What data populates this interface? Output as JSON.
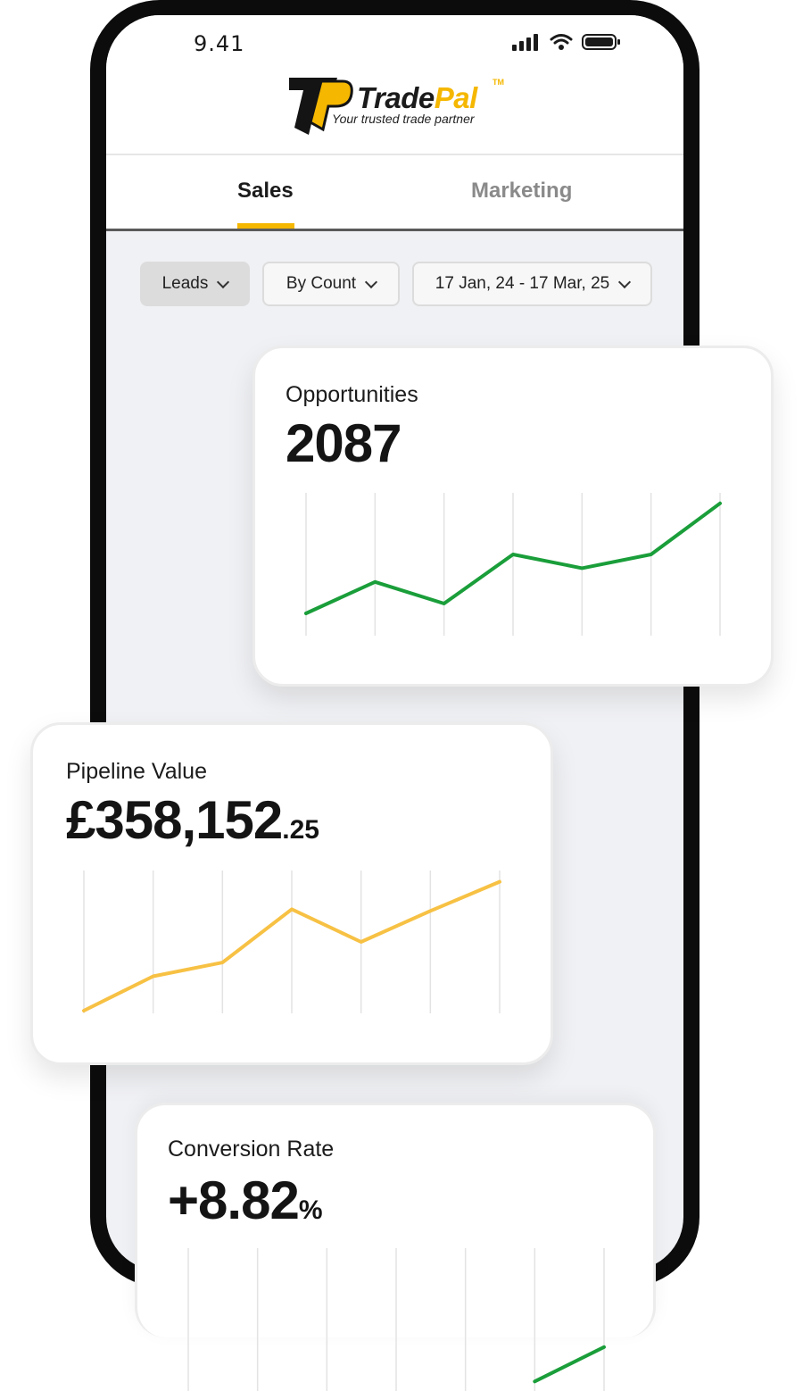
{
  "status": {
    "time": "9.41"
  },
  "brand": {
    "name_part1": "Trade",
    "name_part2": "Pal",
    "trademark": "TM",
    "tagline": "Your trusted trade partner",
    "monogram": "TP"
  },
  "tabs": [
    {
      "label": "Sales",
      "active": true
    },
    {
      "label": "Marketing",
      "active": false
    }
  ],
  "filters": {
    "metric": "Leads",
    "mode": "By Count",
    "date_range": "17 Jan, 24 - 17 Mar, 25"
  },
  "cards": {
    "opportunities": {
      "title": "Opportunities",
      "value": "2087"
    },
    "pipeline": {
      "title": "Pipeline Value",
      "value_main": "£358,152",
      "value_decimal": ".25"
    },
    "conversion": {
      "title": "Conversion Rate",
      "value_main": "+8.82",
      "value_unit": "%"
    }
  },
  "colors": {
    "accent": "#f5b700",
    "green": "#1a9e3a",
    "yellow": "#f7c144",
    "dark": "#141414"
  },
  "chart_data": [
    {
      "type": "line",
      "name": "opportunities",
      "color": "#1a9e3a",
      "values": [
        1.0,
        2.6,
        1.5,
        4.0,
        3.3,
        4.0,
        6.6
      ],
      "ylim": [
        0,
        7
      ]
    },
    {
      "type": "line",
      "name": "pipeline",
      "color": "#f7c144",
      "values": [
        0.0,
        2.0,
        2.8,
        5.9,
        4.0,
        5.8,
        7.5
      ],
      "ylim": [
        0,
        8
      ]
    },
    {
      "type": "line",
      "name": "conversion",
      "color": "#1a9e3a",
      "values": [
        null,
        null,
        null,
        null,
        null,
        0.5,
        3.0
      ],
      "ylim": [
        0,
        10
      ]
    }
  ]
}
